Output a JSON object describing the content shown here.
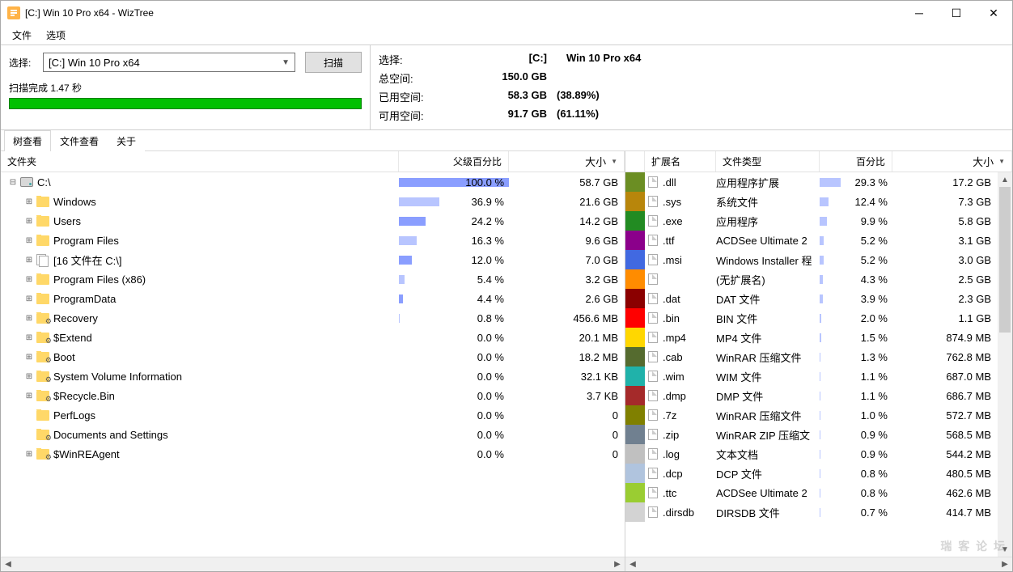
{
  "window": {
    "title": "[C:] Win 10 Pro x64  - WizTree"
  },
  "menu": {
    "file": "文件",
    "options": "选项"
  },
  "scan": {
    "select_label": "选择:",
    "drive": "[C:] Win 10 Pro x64",
    "button": "扫描",
    "status": "扫描完成 1.47 秒"
  },
  "info": {
    "select_label": "选择:",
    "drive_label": "[C:]",
    "drive_name": "Win 10 Pro x64",
    "total_label": "总空间:",
    "total": "150.0 GB",
    "used_label": "已用空间:",
    "used": "58.3 GB",
    "used_pct": "(38.89%)",
    "free_label": "可用空间:",
    "free": "91.7 GB",
    "free_pct": "(61.11%)"
  },
  "tabs": {
    "tree": "树查看",
    "file": "文件查看",
    "about": "关于"
  },
  "cols_left": {
    "folder": "文件夹",
    "pct": "父级百分比",
    "size": "大小"
  },
  "cols_right": {
    "ext": "扩展名",
    "type": "文件类型",
    "pct": "百分比",
    "size": "大小"
  },
  "tree": [
    {
      "indent": 0,
      "exp": "⊟",
      "icon": "drive",
      "name": "C:\\",
      "pct": "100.0 %",
      "pctw": 100,
      "size": "58.7 GB"
    },
    {
      "indent": 1,
      "exp": "⊞",
      "icon": "folder",
      "name": "Windows",
      "pct": "36.9 %",
      "pctw": 37,
      "size": "21.6 GB"
    },
    {
      "indent": 1,
      "exp": "⊞",
      "icon": "folder",
      "name": "Users",
      "pct": "24.2 %",
      "pctw": 24,
      "size": "14.2 GB"
    },
    {
      "indent": 1,
      "exp": "⊞",
      "icon": "folder",
      "name": "Program Files",
      "pct": "16.3 %",
      "pctw": 16,
      "size": "9.6 GB"
    },
    {
      "indent": 1,
      "exp": "⊞",
      "icon": "files",
      "name": "[16 文件在 C:\\]",
      "pct": "12.0 %",
      "pctw": 12,
      "size": "7.0 GB"
    },
    {
      "indent": 1,
      "exp": "⊞",
      "icon": "folder",
      "name": "Program Files (x86)",
      "pct": "5.4 %",
      "pctw": 5,
      "size": "3.2 GB"
    },
    {
      "indent": 1,
      "exp": "⊞",
      "icon": "folder",
      "name": "ProgramData",
      "pct": "4.4 %",
      "pctw": 4,
      "size": "2.6 GB"
    },
    {
      "indent": 1,
      "exp": "⊞",
      "icon": "sys",
      "name": "Recovery",
      "pct": "0.8 %",
      "pctw": 1,
      "size": "456.6 MB"
    },
    {
      "indent": 1,
      "exp": "⊞",
      "icon": "sys",
      "name": "$Extend",
      "pct": "0.0 %",
      "pctw": 0,
      "size": "20.1 MB"
    },
    {
      "indent": 1,
      "exp": "⊞",
      "icon": "sys",
      "name": "Boot",
      "pct": "0.0 %",
      "pctw": 0,
      "size": "18.2 MB"
    },
    {
      "indent": 1,
      "exp": "⊞",
      "icon": "sys",
      "name": "System Volume Information",
      "pct": "0.0 %",
      "pctw": 0,
      "size": "32.1 KB"
    },
    {
      "indent": 1,
      "exp": "⊞",
      "icon": "sys",
      "name": "$Recycle.Bin",
      "pct": "0.0 %",
      "pctw": 0,
      "size": "3.7 KB"
    },
    {
      "indent": 1,
      "exp": "",
      "icon": "folder",
      "name": "PerfLogs",
      "pct": "0.0 %",
      "pctw": 0,
      "size": "0"
    },
    {
      "indent": 1,
      "exp": "",
      "icon": "sys",
      "name": "Documents and Settings",
      "pct": "0.0 %",
      "pctw": 0,
      "size": "0"
    },
    {
      "indent": 1,
      "exp": "⊞",
      "icon": "sys",
      "name": "$WinREAgent",
      "pct": "0.0 %",
      "pctw": 0,
      "size": "0"
    }
  ],
  "ext": [
    {
      "c": "#6b8e23",
      "ext": ".dll",
      "type": "应用程序扩展",
      "pct": "29.3 %",
      "pctw": 29,
      "size": "17.2 GB"
    },
    {
      "c": "#b8860b",
      "ext": ".sys",
      "type": "系统文件",
      "pct": "12.4 %",
      "pctw": 12,
      "size": "7.3 GB"
    },
    {
      "c": "#228b22",
      "ext": ".exe",
      "type": "应用程序",
      "pct": "9.9 %",
      "pctw": 10,
      "size": "5.8 GB"
    },
    {
      "c": "#8b008b",
      "ext": ".ttf",
      "type": "ACDSee Ultimate 2",
      "pct": "5.2 %",
      "pctw": 5,
      "size": "3.1 GB"
    },
    {
      "c": "#4169e1",
      "ext": ".msi",
      "type": "Windows Installer 程",
      "pct": "5.2 %",
      "pctw": 5,
      "size": "3.0 GB"
    },
    {
      "c": "#ff8c00",
      "ext": "",
      "type": "(无扩展名)",
      "pct": "4.3 %",
      "pctw": 4,
      "size": "2.5 GB"
    },
    {
      "c": "#8b0000",
      "ext": ".dat",
      "type": "DAT 文件",
      "pct": "3.9 %",
      "pctw": 4,
      "size": "2.3 GB"
    },
    {
      "c": "#ff0000",
      "ext": ".bin",
      "type": "BIN 文件",
      "pct": "2.0 %",
      "pctw": 2,
      "size": "1.1 GB"
    },
    {
      "c": "#ffd700",
      "ext": ".mp4",
      "type": "MP4 文件",
      "pct": "1.5 %",
      "pctw": 2,
      "size": "874.9 MB"
    },
    {
      "c": "#556b2f",
      "ext": ".cab",
      "type": "WinRAR 压缩文件",
      "pct": "1.3 %",
      "pctw": 1,
      "size": "762.8 MB"
    },
    {
      "c": "#20b2aa",
      "ext": ".wim",
      "type": "WIM 文件",
      "pct": "1.1 %",
      "pctw": 1,
      "size": "687.0 MB"
    },
    {
      "c": "#a52a2a",
      "ext": ".dmp",
      "type": "DMP 文件",
      "pct": "1.1 %",
      "pctw": 1,
      "size": "686.7 MB"
    },
    {
      "c": "#808000",
      "ext": ".7z",
      "type": "WinRAR 压缩文件",
      "pct": "1.0 %",
      "pctw": 1,
      "size": "572.7 MB"
    },
    {
      "c": "#708090",
      "ext": ".zip",
      "type": "WinRAR ZIP 压缩文",
      "pct": "0.9 %",
      "pctw": 1,
      "size": "568.5 MB"
    },
    {
      "c": "#c0c0c0",
      "ext": ".log",
      "type": "文本文档",
      "pct": "0.9 %",
      "pctw": 1,
      "size": "544.2 MB"
    },
    {
      "c": "#b0c4de",
      "ext": ".dcp",
      "type": "DCP 文件",
      "pct": "0.8 %",
      "pctw": 1,
      "size": "480.5 MB"
    },
    {
      "c": "#9acd32",
      "ext": ".ttc",
      "type": "ACDSee Ultimate 2",
      "pct": "0.8 %",
      "pctw": 1,
      "size": "462.6 MB"
    },
    {
      "c": "#d3d3d3",
      "ext": ".dirsdb",
      "type": "DIRSDB 文件",
      "pct": "0.7 %",
      "pctw": 1,
      "size": "414.7 MB"
    }
  ],
  "watermark": "瑞 客 论 坛"
}
